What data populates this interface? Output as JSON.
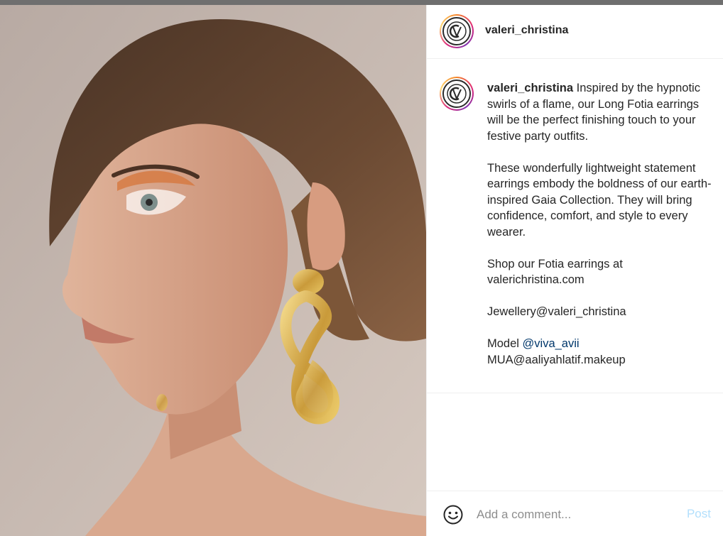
{
  "post": {
    "photo_alt": "Model in profile wearing long gold Fotia earrings"
  },
  "header": {
    "username": "valeri_christina",
    "avatar_monogram": "CV"
  },
  "caption": {
    "username": "valeri_christina",
    "avatar_monogram": "CV",
    "line1": "Inspired by the hypnotic swirls of a flame, our Long Fotia earrings will be the perfect finishing touch to your festive party outfits.",
    "para2": "These wonderfully lightweight statement earrings embody the boldness of our earth-inspired Gaia Collection. They will bring confidence, comfort, and style to every wearer.",
    "para3": "Shop our Fotia earrings at valerichristina.com",
    "jewellery": "Jewellery@valeri_christina",
    "model_prefix": "Model ",
    "model_mention": "@viva_avii",
    "mua": "MUA@aaliyahlatif.makeup"
  },
  "comment": {
    "placeholder": "Add a comment...",
    "post_label": "Post"
  },
  "colors": {
    "mention": "#00376b",
    "post_disabled": "#b2dffc",
    "border": "#efefef"
  },
  "icons": {
    "emoji": "smiley-face-icon"
  }
}
